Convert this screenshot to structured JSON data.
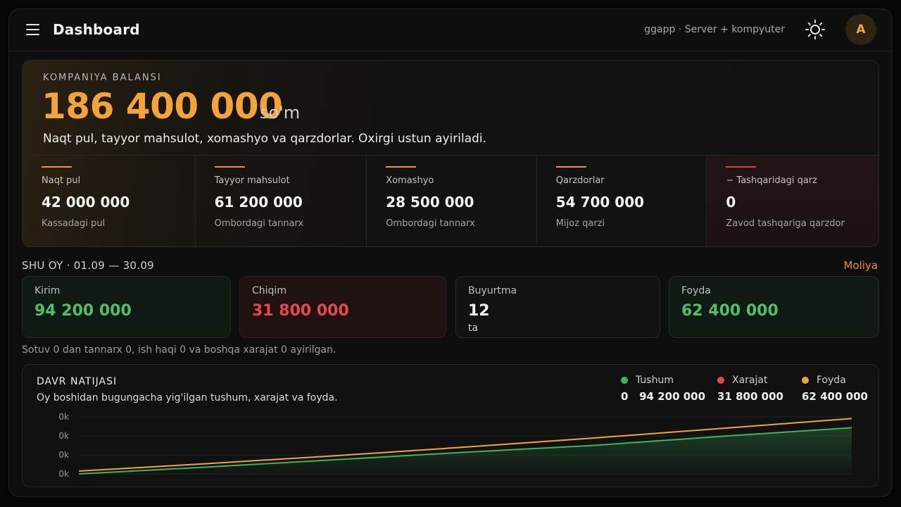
{
  "header": {
    "title": "Dashboard",
    "app_label": "ggapp · Server + kompyuter",
    "avatar_letter": "A",
    "menu_icon": "hamburger-menu-icon",
    "theme_icon": "sun-icon"
  },
  "balance": {
    "kicker": "KOMPANIYA BALANSI",
    "amount": "186 400 000",
    "unit": "so'm",
    "description": "Naqt pul, tayyor mahsulot, xomashyo va qarzdorlar. Oxirgi ustun ayiriladi.",
    "components": [
      {
        "label": "Naqt pul",
        "value": "42 000 000",
        "note": "Kassadagi pul"
      },
      {
        "label": "Tayyor mahsulot",
        "value": "61 200 000",
        "note": "Ombordagi tannarx"
      },
      {
        "label": "Xomashyo",
        "value": "28 500 000",
        "note": "Ombordagi tannarx"
      },
      {
        "label": "Qarzdorlar",
        "value": "54 700 000",
        "note": "Mijoz qarzi"
      },
      {
        "label": "− Tashqaridagi qarz",
        "value": "0",
        "note": "Zavod tashqariga qarzdor"
      }
    ]
  },
  "month": {
    "title": "SHU OY · 01.09 — 30.09",
    "link": "Moliya",
    "stats": [
      {
        "label": "Kirim",
        "value": "94 200 000",
        "sub": ""
      },
      {
        "label": "Chiqim",
        "value": "31 800 000",
        "sub": ""
      },
      {
        "label": "Buyurtma",
        "value": "12",
        "sub": "ta"
      },
      {
        "label": "Foyda",
        "value": "62 400 000",
        "sub": ""
      }
    ],
    "note": "Sotuv 0 dan tannarx 0, ish haqi 0 va boshqa xarajat 0 ayirilgan."
  },
  "period": {
    "title": "DAVR NATIJASI",
    "description": "Oy boshidan bugungacha yig'ilgan tushum, xarajat va foyda.",
    "legend": [
      {
        "name": "Tushum",
        "value": "0   94 200 000",
        "color": "#3fb45e"
      },
      {
        "name": "Xarajat",
        "value": "31 800 000",
        "color": "#e5484d"
      },
      {
        "name": "Foyda",
        "value": "62 400 000",
        "color": "#f0a43a"
      }
    ]
  },
  "chart_data": {
    "type": "line",
    "title": "",
    "xlabel": "",
    "ylabel": "",
    "yticks": [
      "0k",
      "0k",
      "0k",
      "0k"
    ],
    "grid": true,
    "legend": "top-right",
    "series": [
      {
        "name": "Foyda",
        "color": "#f0a43a",
        "y_frac": [
          0.05,
          0.18,
          0.32,
          0.47,
          0.63,
          0.8,
          0.97
        ],
        "fill": false
      },
      {
        "name": "Tushum",
        "color": "#3fb45e",
        "y_frac": [
          0.0,
          0.12,
          0.25,
          0.38,
          0.5,
          0.66,
          0.81
        ],
        "fill": true
      }
    ]
  },
  "colors": {
    "accent": "#f0a43a",
    "positive": "#4fbf6c",
    "negative": "#e5484d",
    "background": "#0e0e0e"
  }
}
